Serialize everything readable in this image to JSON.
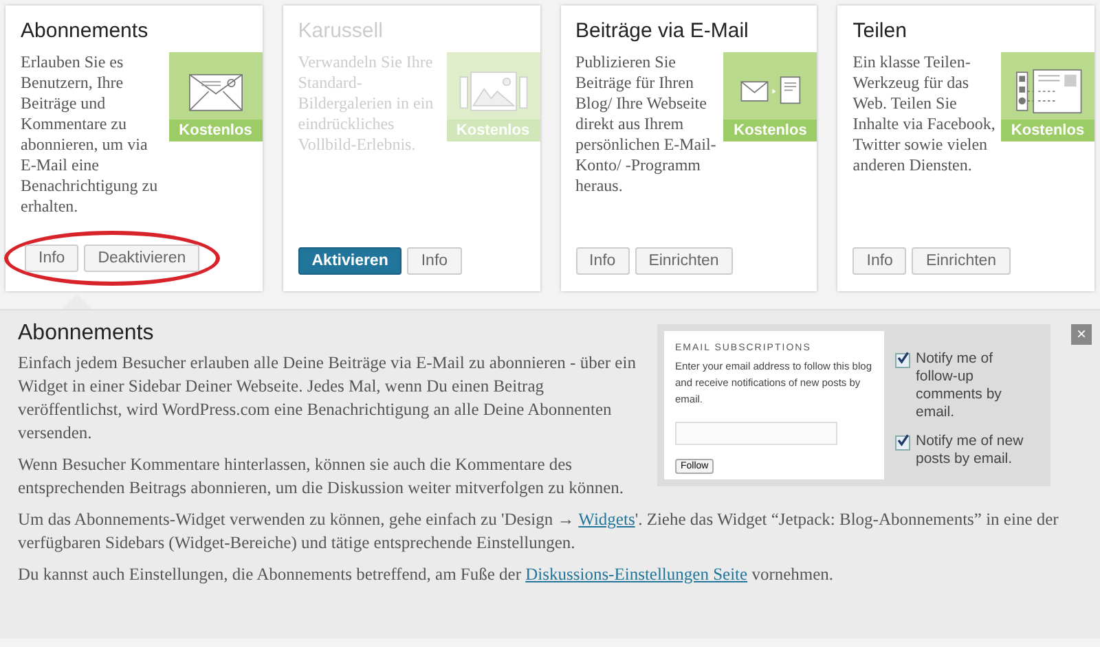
{
  "cards": [
    {
      "title": "Abonnements",
      "description": "Erlauben Sie es Benutzern, Ihre Beiträge und Kommentare zu abonnieren, um via E-Mail eine Benachrichtigung zu erhalten.",
      "badge": "Kostenlos",
      "disabled": false,
      "expanded": true,
      "highlighted": true,
      "buttons": [
        {
          "label": "Info",
          "kind": "plain"
        },
        {
          "label": "Deaktivieren",
          "kind": "plain"
        }
      ]
    },
    {
      "title": "Karussell",
      "description": "Verwandeln Sie Ihre Standard-Bildergalerien in ein eindrückliches Vollbild-Erlebnis.",
      "badge": "Kostenlos",
      "disabled": true,
      "expanded": false,
      "highlighted": false,
      "buttons": [
        {
          "label": "Aktivieren",
          "kind": "primary"
        },
        {
          "label": "Info",
          "kind": "plain"
        }
      ]
    },
    {
      "title": "Beiträge via E-Mail",
      "description": "Publizieren Sie Beiträge für Ihren Blog/ Ihre Webseite direkt aus Ihrem persönlichen E-Mail-Konto/ -Programm heraus.",
      "badge": "Kostenlos",
      "disabled": false,
      "expanded": false,
      "highlighted": false,
      "buttons": [
        {
          "label": "Info",
          "kind": "plain"
        },
        {
          "label": "Einrichten",
          "kind": "plain"
        }
      ]
    },
    {
      "title": "Teilen",
      "description": "Ein klasse Teilen-Werkzeug für das Web. Teilen Sie Inhalte via Facebook, Twitter sowie vielen anderen Diensten.",
      "badge": "Kostenlos",
      "disabled": false,
      "expanded": false,
      "highlighted": false,
      "buttons": [
        {
          "label": "Info",
          "kind": "plain"
        },
        {
          "label": "Einrichten",
          "kind": "plain"
        }
      ]
    }
  ],
  "detail": {
    "title": "Abonnements",
    "close": "×",
    "widget": {
      "heading": "EMAIL SUBSCRIPTIONS",
      "text": "Enter your email address to follow this blog and receive notifications of new posts by email.",
      "button": "Follow",
      "options": [
        {
          "label": "Notify me of follow-up comments by email.",
          "checked": true
        },
        {
          "label": "Notify me of new posts by email.",
          "checked": true
        }
      ]
    },
    "paragraphs": [
      {
        "text": "Einfach jedem Besucher erlauben alle Deine Beiträge via E-Mail zu abonnieren - über ein Widget in einer Sidebar Deiner Webseite. Jedes Mal, wenn Du einen Beitrag veröffentlichst, wird WordPress.com eine Benachrichtigung an alle Deine Abonnenten versenden."
      },
      {
        "text": "Wenn Besucher Kommentare hinterlassen, können sie auch die Kommentare des entsprechenden Beitrags abonnieren, um die Diskussion weiter mitverfolgen zu können."
      },
      {
        "text": "Um das Abonnements-Widget verwenden zu können, gehe einfach zu 'Design → ",
        "link": "Widgets",
        "after": "'. Ziehe das Widget “Jetpack: Blog-Abonnements” in eine der verfügbaren Sidebars (Widget-Bereiche) und tätige entsprechende Einstellungen."
      },
      {
        "text": "Du kannst auch Einstellungen, die Abonnements betreffend, am Fuße der ",
        "link": "Diskussions-Einstellungen Seite",
        "after": " vornehmen."
      }
    ]
  }
}
